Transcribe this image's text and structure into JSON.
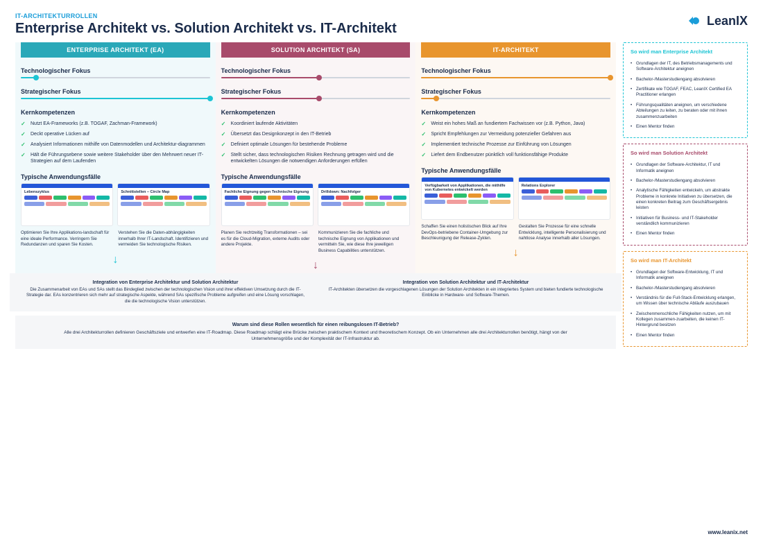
{
  "kicker": "IT-ARCHITEKTURROLLEN",
  "title": "Enterprise Architekt vs. Solution Architekt vs. IT-Architekt",
  "logo": "LeanIX",
  "footer": "www.leanix.net",
  "columns": [
    {
      "key": "ea",
      "header": "ENTERPRISE ARCHITEKT (EA)",
      "techLabel": "Technologischer Fokus",
      "techPct": 8,
      "stratLabel": "Strategischer Fokus",
      "stratPct": 100,
      "compTitle": "Kernkompetenzen",
      "comps": [
        "Nutzt EA-Frameworks (z.B. TOGAF, Zachman-Framework)",
        "Deckt operative Lücken auf",
        "Analysiert Informationen mithilfe von Datenmodellen und Architektur-diagrammen",
        "Hält die Führungsebene sowie weitere Stakeholder über den Mehrwert neuer IT-Strategien auf dem Laufenden"
      ],
      "ucTitle": "Typische Anwendungsfälle",
      "cardTitles": [
        "Lebenszyklus",
        "Schnittstellen – Circle Map"
      ],
      "desc1": "Optimieren Sie Ihre Applikations-landschaft für eine ideale Performance. Verringern Sie Redundanzen und sparen Sie Kosten.",
      "desc2": "Verstehen Sie die Daten-abhängigkeiten innerhalb Ihrer IT-Landschaft. Identifizieren und vermeiden Sie technologische Risiken."
    },
    {
      "key": "sa",
      "header": "SOLUTION ARCHITEKT (SA)",
      "techLabel": "Technologischer Fokus",
      "techPct": 52,
      "stratLabel": "Strategischer Fokus",
      "stratPct": 52,
      "compTitle": "Kernkompetenzen",
      "comps": [
        "Koordiniert laufende Aktivitäten",
        "Übersetzt das Designkonzept in den IT-Betrieb",
        "Definiert optimale Lösungen für bestehende Probleme",
        "Stellt sicher, dass technologischen Risiken Rechnung getragen wird und die entwickelten Lösungen die notwendigen Anforderungen erfüllen"
      ],
      "ucTitle": "Typische Anwendungsfälle",
      "cardTitles": [
        "Fachliche Eignung gegen Technische Eignung",
        "Drilldown: Nachfolger"
      ],
      "desc1": "Planen Sie rechtzeitig Transformationen – sei es für die Cloud-Migration, externe Audits oder andere Projekte.",
      "desc2": "Kommunizieren Sie die fachliche und technische Eignung von Applikationen und vermitteln Sie, wie diese Ihre jeweiligen Business Capabilities unterstützen."
    },
    {
      "key": "it",
      "header": "IT-ARCHITEKT",
      "techLabel": "Technologischer Fokus",
      "techPct": 100,
      "stratLabel": "Strategischer Fokus",
      "stratPct": 8,
      "compTitle": "Kernkompetenzen",
      "comps": [
        "Weist ein hohes Maß an fundiertem Fachwissen vor (z.B. Python, Java)",
        "Spricht Empfehlungen zur Vermeidung potenzieller Gefahren aus",
        "Implementiert technische Prozesse zur Einführung von Lösungen",
        "Liefert dem Endbenutzer pünktlich voll funktionsfähige Produkte"
      ],
      "ucTitle": "Typische Anwendungsfälle",
      "cardTitles": [
        "Verfügbarkeit von Applikationen, die mithilfe von Kubernetes entwickelt werden",
        "Relations Explorer"
      ],
      "desc1": "Schaffen Sie einen holistischen Blick auf Ihre DevOps-betriebene Container-Umgebung zur Beschleunigung der Release-Zyklen.",
      "desc2": "Gestalten Sie Prozesse für eine schnelle Entwicklung, intelligente Personalisierung und nahtlose Analyse innerhalb aller Lösungen."
    }
  ],
  "integrations": [
    {
      "title": "Integration von Enterprise Architektur und Solution Architektur",
      "text": "Die Zusammenarbeit von EAs und SAs stellt das Bindeglied zwischen der technologischen Vision und ihrer effektiven Umsetzung durch die IT-Strategie dar. EAs konzentrieren sich mehr auf strategische Aspekte, während SAs spezifische Probleme aufgreifen und eine Lösung vorschlagen, die die technologische Vision unterstützen."
    },
    {
      "title": "Integration von Solution Architektur und IT-Architektur",
      "text": "IT-Architekten übersetzen die vorgeschlagenen Lösungen der Solution Architekten in ein integriertes System und bieten fundierte technologische Einblicke in Hardware- und Software-Themen."
    }
  ],
  "summary": {
    "title": "Warum sind diese Rollen wesentlich für einen reibungslosen IT-Betrieb?",
    "text": "Alle drei Architekturrollen definieren Geschäftsziele und entwerfen eine IT-Roadmap. Diese Roadmap schlägt eine Brücke zwischen praktischem Kontext und theoretischem Konzept. Ob ein Unternehmen alle drei Architekturrollen benötigt, hängt von der Unternehmensgröße und der Komplexität der IT-Infrastruktur ab."
  },
  "sideboxes": [
    {
      "cls": "ea-box",
      "title": "So wird man Enterprise Architekt",
      "items": [
        "Grundlagen der IT, des Betriebsmanagements und Software-Architektur aneignen",
        "Bachelor-/Masterstudiengang absolvieren",
        "Zertifikate wie TOGAF, FEAC, LeanIX Certified EA Practitioner erlangen",
        "Führungsqualitäten aneignen, um verschiedene Abteilungen zu leiten, zu beraten oder mit ihnen zusammenzuarbeiten",
        "Einen Mentor finden"
      ]
    },
    {
      "cls": "sa-box",
      "title": "So wird man Solution Architekt",
      "items": [
        "Grundlagen der Software-Architektur, IT und Informatik aneignen",
        "Bachelor-/Masterstudiengang absolvieren",
        "Analytische Fähigkeiten entwickeln, um abstrakte Probleme in konkrete Initiativen zu übersetzen, die einen konkreten Beitrag zum Geschäftsergebnis leisten",
        "Initiativen für Business- und IT-Stakeholder verständlich kommunizieren",
        "Einen Mentor finden"
      ]
    },
    {
      "cls": "it-box",
      "title": "So wird man IT-Architekt",
      "items": [
        "Grundlagen der Software-Entwicklung, IT und Informatik aneignen",
        "Bachelor-/Masterstudiengang absolvieren",
        "Verständnis für die Full-Stack-Entwicklung erlangen, um Wissen über technische Abläufe auszubauen",
        "Zwischenmenschliche Fähigkeiten nutzen, um mit Kollegen zusammen-zuarbeiten, die keinen IT-Hintergrund besitzen",
        "Einen Mentor finden"
      ]
    }
  ],
  "chipColors": [
    "#3b5fd8",
    "#e85c5c",
    "#2dbf6e",
    "#e8952e",
    "#8b5cf6",
    "#14b8a6"
  ]
}
